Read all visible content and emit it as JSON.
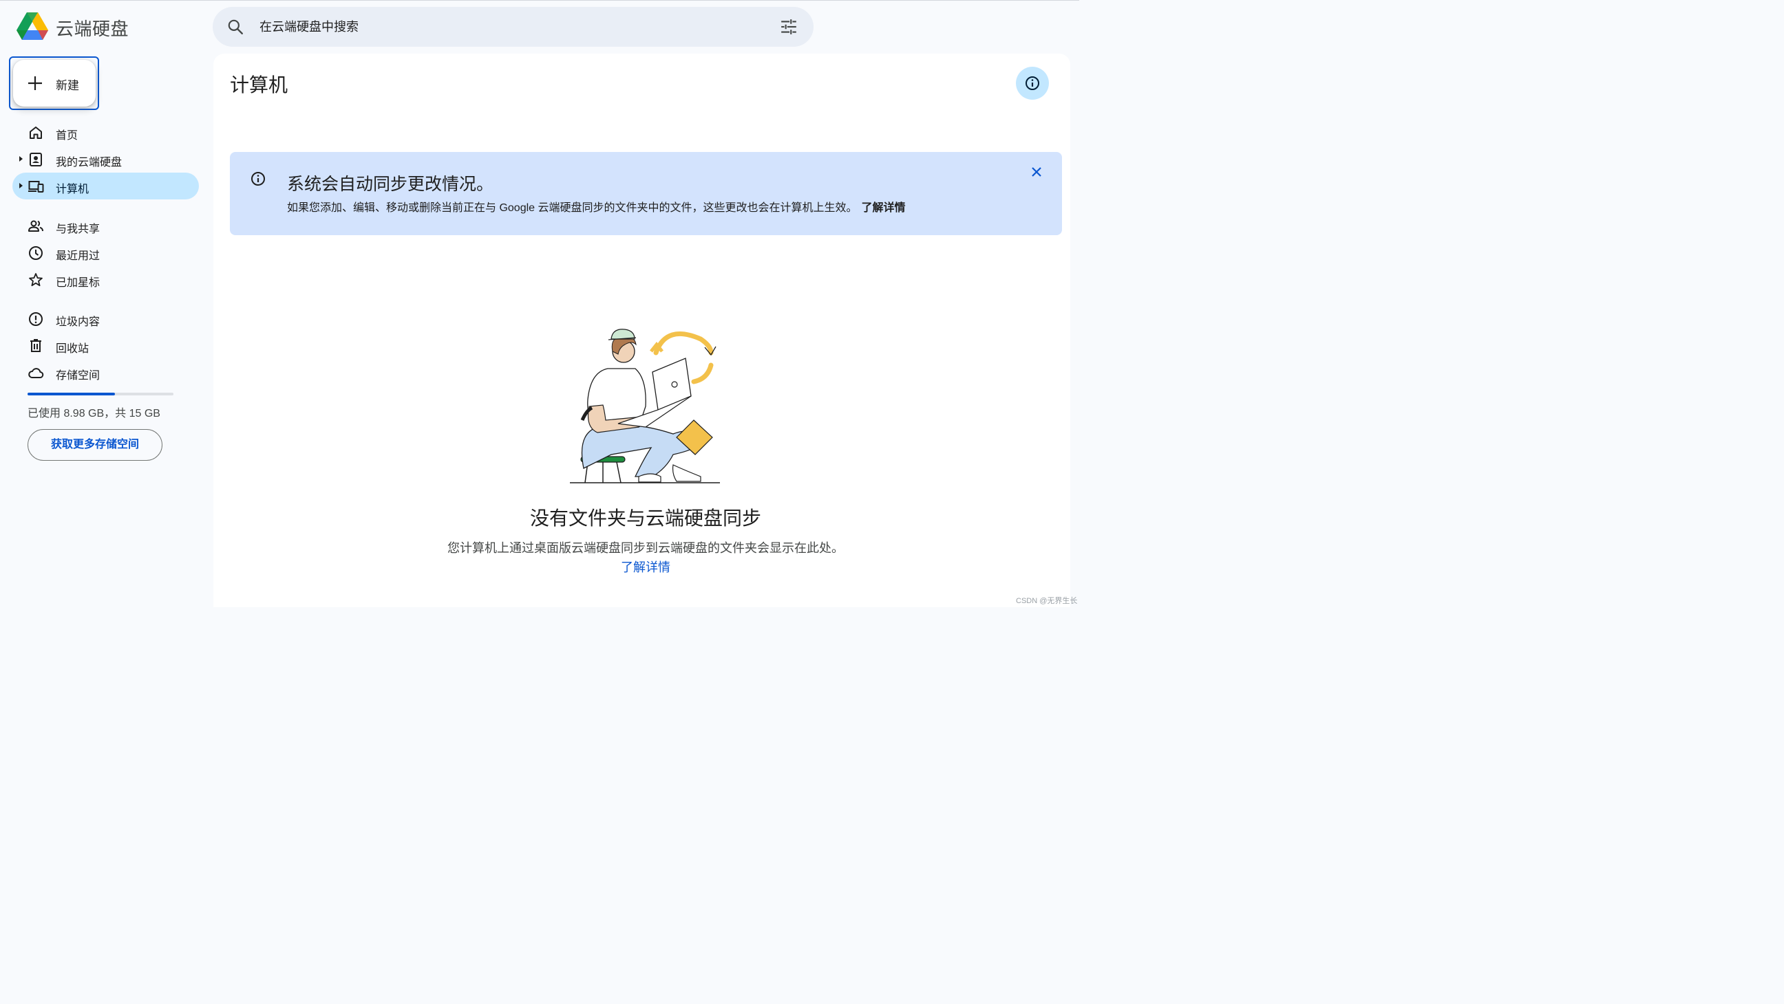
{
  "app": {
    "title": "云端硬盘"
  },
  "search": {
    "placeholder": "在云端硬盘中搜索",
    "icon": "search-icon",
    "filter_icon": "tune-icon"
  },
  "sidebar": {
    "new_label": "新建",
    "items": [
      {
        "label": "首页",
        "icon": "home-icon",
        "active": false,
        "caret": false
      },
      {
        "label": "我的云端硬盘",
        "icon": "my-drive-icon",
        "active": false,
        "caret": true
      },
      {
        "label": "计算机",
        "icon": "computers-icon",
        "active": true,
        "caret": true
      },
      {
        "label": "与我共享",
        "icon": "shared-people-icon",
        "active": false,
        "caret": false
      },
      {
        "label": "最近用过",
        "icon": "clock-icon",
        "active": false,
        "caret": false
      },
      {
        "label": "已加星标",
        "icon": "star-icon",
        "active": false,
        "caret": false
      },
      {
        "label": "垃圾内容",
        "icon": "spam-icon",
        "active": false,
        "caret": false
      },
      {
        "label": "回收站",
        "icon": "trash-icon",
        "active": false,
        "caret": false
      },
      {
        "label": "存储空间",
        "icon": "cloud-icon",
        "active": false,
        "caret": false
      }
    ],
    "storage": {
      "used_text": "已使用 8.98 GB，共 15 GB",
      "used_fraction": 0.599,
      "button_label": "获取更多存储空间"
    }
  },
  "main": {
    "title": "计算机",
    "banner": {
      "title": "系统会自动同步更改情况。",
      "body": "如果您添加、编辑、移动或删除当前正在与 Google 云端硬盘同步的文件夹中的文件，这些更改也会在计算机上生效。",
      "link": "了解详情"
    },
    "empty_state": {
      "title": "没有文件夹与云端硬盘同步",
      "description": "您计算机上通过桌面版云端硬盘同步到云端硬盘的文件夹会显示在此处。",
      "link": "了解详情"
    }
  },
  "watermark": "CSDN @无界生长",
  "colors": {
    "accent": "#0b57d0",
    "active_bg": "#c2e7ff",
    "banner_bg": "#d3e3fd",
    "search_bg": "#e9eef6"
  }
}
